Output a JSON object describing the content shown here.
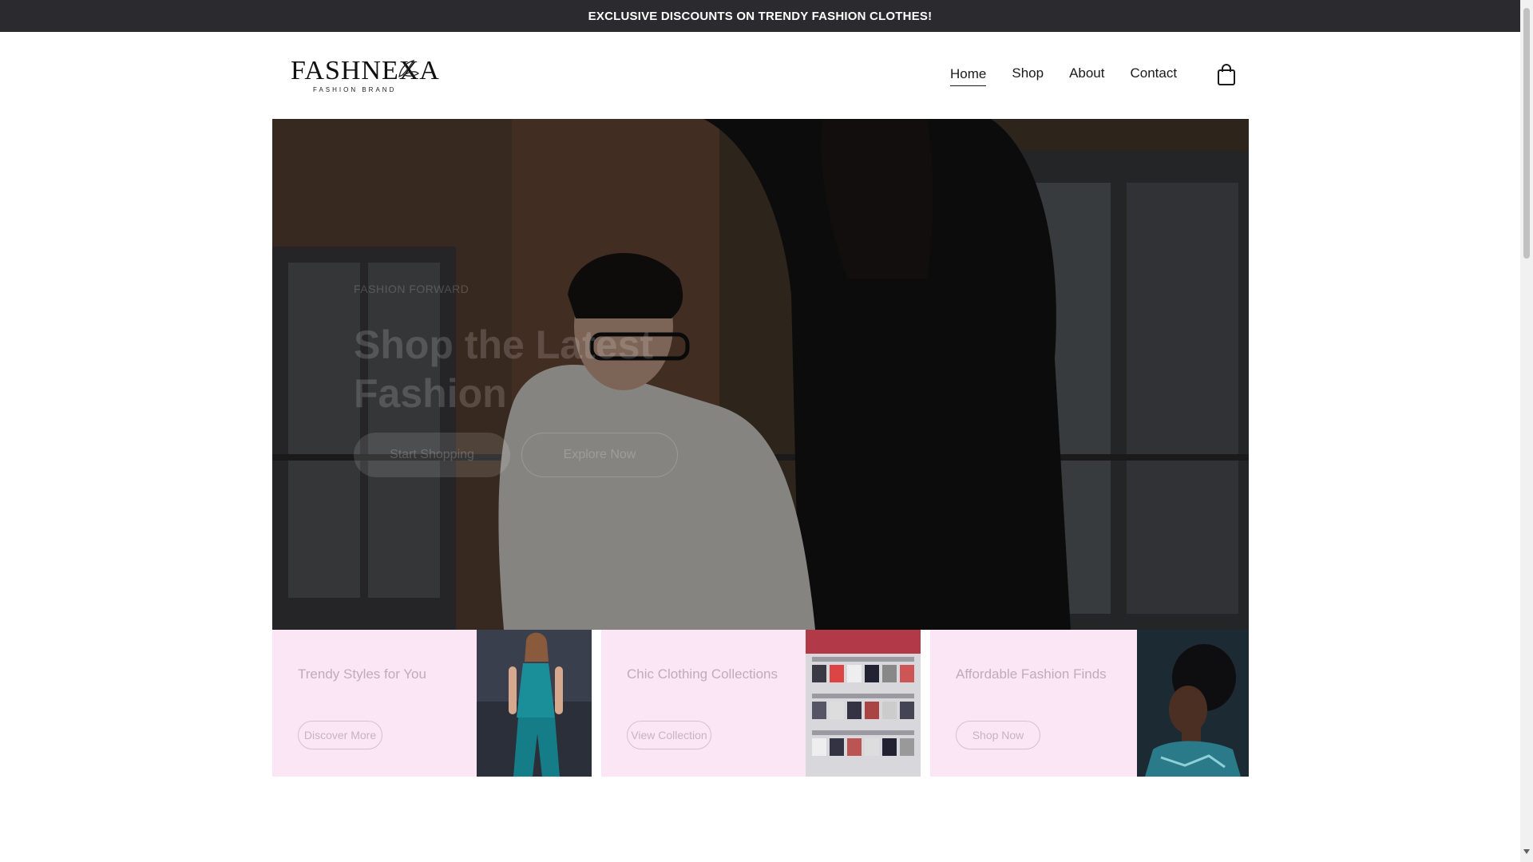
{
  "announcement": "EXCLUSIVE DISCOUNTS ON TRENDY FASHION CLOTHES!",
  "logo": {
    "name": "FASHNEXA",
    "tagline": "FASHION BRAND"
  },
  "nav": {
    "items": [
      {
        "label": "Home",
        "active": true
      },
      {
        "label": "Shop",
        "active": false
      },
      {
        "label": "About",
        "active": false
      },
      {
        "label": "Contact",
        "active": false
      }
    ],
    "cart_icon": "shopping-bag-icon"
  },
  "hero": {
    "eyebrow": "FASHION FORWARD",
    "title_line1": "Shop the Latest",
    "title_line2": "Fashion",
    "primary_button": "Start Shopping",
    "secondary_button": "Explore Now"
  },
  "cards": [
    {
      "title": "Trendy Styles for You",
      "button": "Discover More",
      "image": "woman-teal-jumpsuit-photo"
    },
    {
      "title": "Chic Clothing Collections",
      "button": "View Collection",
      "image": "clothing-store-shelves-photo"
    },
    {
      "title": "Affordable Fashion Finds",
      "button": "Shop Now",
      "image": "woman-profile-photo"
    }
  ],
  "colors": {
    "announcement_bg": "#2b2b2f",
    "card_bg": "#fbe6f5",
    "text": "#1a1a1a"
  }
}
